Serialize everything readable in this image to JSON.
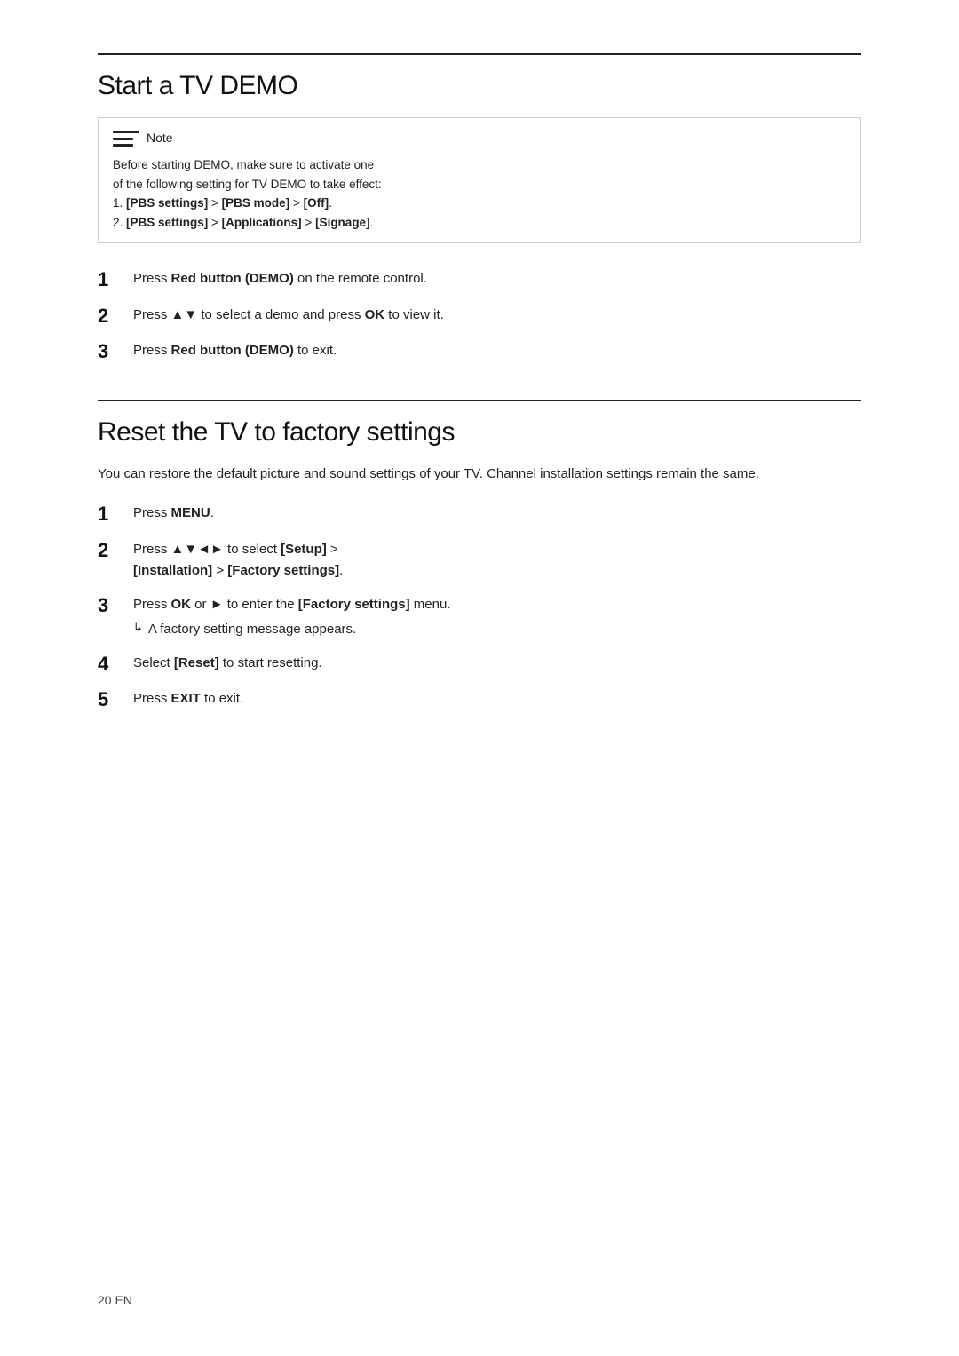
{
  "page": {
    "footer": "20   EN"
  },
  "section1": {
    "title": "Start a TV DEMO",
    "note": {
      "label": "Note",
      "lines": [
        "Before starting DEMO, make sure to activate one",
        "of the following setting for TV DEMO to take effect:",
        "1. [PBS settings] > [PBS mode] > [Off].",
        "2. [PBS settings] > [Applications] > [Signage]."
      ],
      "line1": "Before starting DEMO, make sure to activate one",
      "line2": "of the following setting for TV DEMO to take effect:",
      "line3_prefix": "1. ",
      "line3_bold": "[PBS settings]",
      "line3_mid": " > ",
      "line3_bold2": "[PBS mode]",
      "line3_mid2": " > ",
      "line3_bold3": "[Off]",
      "line3_end": ".",
      "line4_prefix": "2. ",
      "line4_bold": "[PBS settings]",
      "line4_mid": " > ",
      "line4_bold2": "[Applications]",
      "line4_mid2": " > ",
      "line4_bold3": "[Signage]",
      "line4_end": "."
    },
    "steps": [
      {
        "number": "1",
        "text_prefix": "Press ",
        "text_bold": "Red button (DEMO)",
        "text_suffix": " on the remote control."
      },
      {
        "number": "2",
        "text_prefix": "Press ▲▼ to select a demo and press ",
        "text_bold": "OK",
        "text_suffix": " to view it."
      },
      {
        "number": "3",
        "text_prefix": "Press ",
        "text_bold": "Red button (DEMO)",
        "text_suffix": " to exit."
      }
    ]
  },
  "section2": {
    "title": "Reset the TV to factory settings",
    "intro": "You can restore the default picture and sound settings of your TV. Channel installation settings remain the same.",
    "steps": [
      {
        "number": "1",
        "text_prefix": "Press ",
        "text_bold": "MENU",
        "text_suffix": ".",
        "has_sub": false
      },
      {
        "number": "2",
        "text_prefix": "Press ▲▼◄► to select ",
        "text_bold": "[Setup]",
        "text_mid": " >",
        "text_suffix": "",
        "line2_bold1": "[Installation]",
        "line2_mid": " > ",
        "line2_bold2": "[Factory settings]",
        "line2_end": ".",
        "has_sub": false,
        "multiline": true
      },
      {
        "number": "3",
        "text_prefix": "Press ",
        "text_bold": "OK",
        "text_mid": " or ► to enter the ",
        "text_bold2": "[Factory settings]",
        "text_suffix": " menu.",
        "sub_text": "A factory setting message appears.",
        "has_sub": true
      },
      {
        "number": "4",
        "text_prefix": "Select ",
        "text_bold": "[Reset]",
        "text_suffix": " to start resetting.",
        "has_sub": false
      },
      {
        "number": "5",
        "text_prefix": "Press ",
        "text_bold": "EXIT",
        "text_suffix": " to exit.",
        "has_sub": false
      }
    ]
  }
}
